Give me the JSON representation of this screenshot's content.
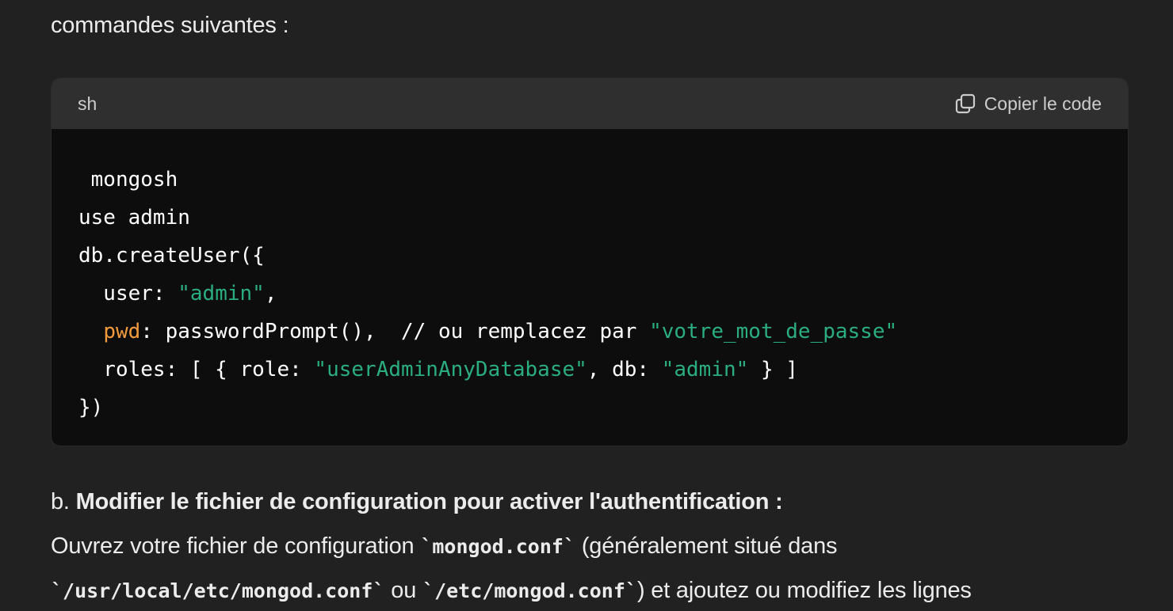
{
  "intro_text": "commandes suivantes :",
  "code_block": {
    "language": "sh",
    "copy_label": "Copier le code",
    "copy_icon": "copy-icon",
    "colors": {
      "string": "#2bae7f",
      "keyword": "#f29b3c",
      "plain": "#ffffff"
    },
    "lines": [
      [
        {
          "t": " mongosh",
          "c": "plain"
        }
      ],
      [
        {
          "t": "use admin",
          "c": "plain"
        }
      ],
      [
        {
          "t": "db.createUser({",
          "c": "plain"
        }
      ],
      [
        {
          "t": "  user: ",
          "c": "plain"
        },
        {
          "t": "\"admin\"",
          "c": "str"
        },
        {
          "t": ",",
          "c": "plain"
        }
      ],
      [
        {
          "t": "  ",
          "c": "plain"
        },
        {
          "t": "pwd",
          "c": "key"
        },
        {
          "t": ": passwordPrompt(),  // ou remplacez par ",
          "c": "plain"
        },
        {
          "t": "\"votre_mot_de_passe\"",
          "c": "str"
        }
      ],
      [
        {
          "t": "  roles: [ { role: ",
          "c": "plain"
        },
        {
          "t": "\"userAdminAnyDatabase\"",
          "c": "str"
        },
        {
          "t": ", db: ",
          "c": "plain"
        },
        {
          "t": "\"admin\"",
          "c": "str"
        },
        {
          "t": " } ]",
          "c": "plain"
        }
      ],
      [
        {
          "t": "})",
          "c": "plain"
        }
      ]
    ]
  },
  "step": {
    "prefix": "b. ",
    "title": "Modifier le fichier de configuration pour activer l'authentification :",
    "body_1_a": "Ouvrez votre fichier de configuration ",
    "body_1_code": "`mongod.conf`",
    "body_1_b": " (généralement situé dans",
    "body_2_code_1": "`/usr/local/etc/mongod.conf`",
    "body_2_a": " ou ",
    "body_2_code_2": "`/etc/mongod.conf`",
    "body_2_b": ") et ajoutez ou modifiez les lignes"
  }
}
